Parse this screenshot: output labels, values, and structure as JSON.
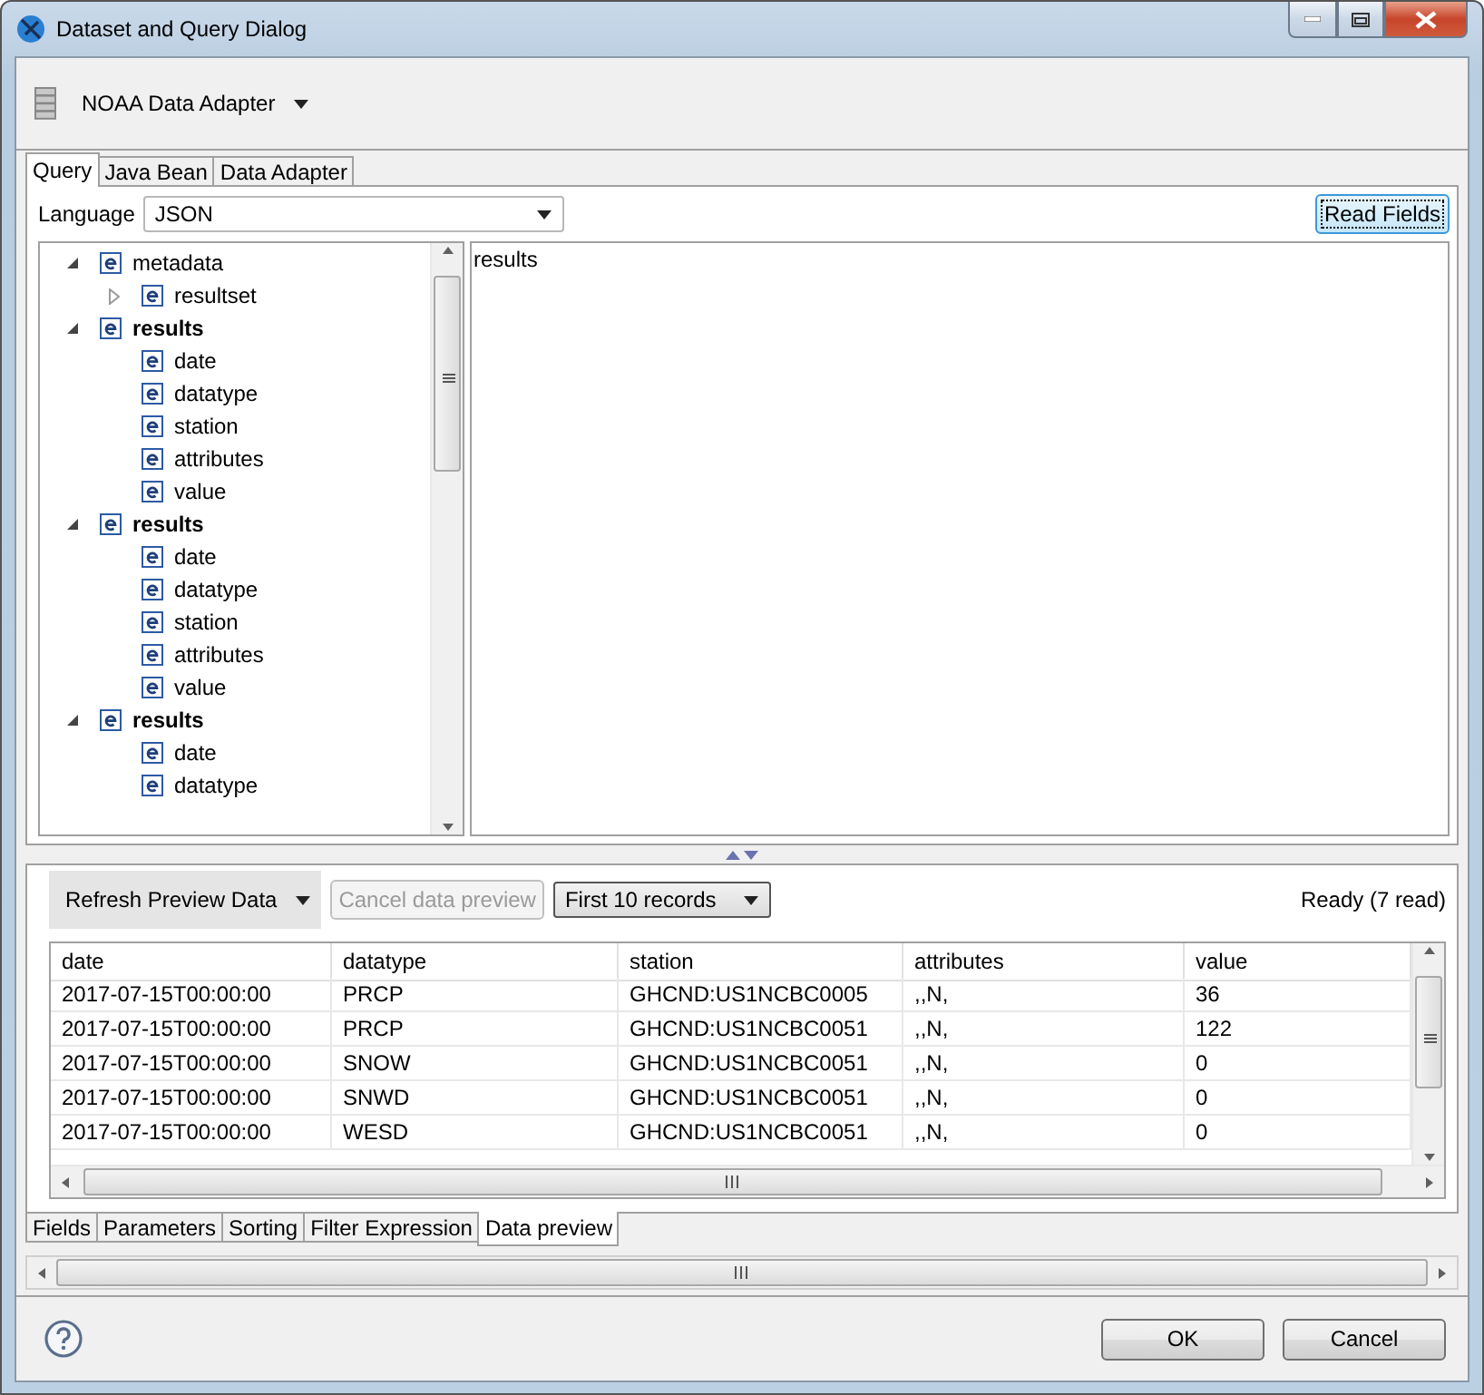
{
  "window": {
    "title": "Dataset and Query Dialog"
  },
  "data_adapter": {
    "label": "NOAA Data Adapter"
  },
  "top_tabs": [
    {
      "label": "Query",
      "selected": true
    },
    {
      "label": "Java Bean",
      "selected": false
    },
    {
      "label": "Data Adapter",
      "selected": false
    }
  ],
  "language": {
    "label": "Language",
    "value": "JSON"
  },
  "read_fields_button": "Read Fields",
  "tree": [
    {
      "label": "metadata",
      "bold": false,
      "expanded": true,
      "children": [
        {
          "label": "resultset",
          "bold": false,
          "expanded": false
        }
      ]
    },
    {
      "label": "results",
      "bold": true,
      "expanded": true,
      "children": [
        {
          "label": "date"
        },
        {
          "label": "datatype"
        },
        {
          "label": "station"
        },
        {
          "label": "attributes"
        },
        {
          "label": "value"
        }
      ]
    },
    {
      "label": "results",
      "bold": true,
      "expanded": true,
      "children": [
        {
          "label": "date"
        },
        {
          "label": "datatype"
        },
        {
          "label": "station"
        },
        {
          "label": "attributes"
        },
        {
          "label": "value"
        }
      ]
    },
    {
      "label": "results",
      "bold": true,
      "expanded": true,
      "children": [
        {
          "label": "date"
        },
        {
          "label": "datatype"
        }
      ]
    }
  ],
  "query_text": "results",
  "preview": {
    "refresh_button": "Refresh Preview Data",
    "cancel_button": {
      "label": "Cancel data preview",
      "disabled": true
    },
    "records_select": "First 10 records",
    "status": "Ready (7 read)"
  },
  "table": {
    "columns": [
      "date",
      "datatype",
      "station",
      "attributes",
      "value"
    ],
    "rows": [
      [
        "2017-07-15T00:00:00",
        "PRCP",
        "GHCND:US1NCBC0005",
        ",,N,",
        "36"
      ],
      [
        "2017-07-15T00:00:00",
        "PRCP",
        "GHCND:US1NCBC0051",
        ",,N,",
        "122"
      ],
      [
        "2017-07-15T00:00:00",
        "SNOW",
        "GHCND:US1NCBC0051",
        ",,N,",
        "0"
      ],
      [
        "2017-07-15T00:00:00",
        "SNWD",
        "GHCND:US1NCBC0051",
        ",,N,",
        "0"
      ],
      [
        "2017-07-15T00:00:00",
        "WESD",
        "GHCND:US1NCBC0051",
        ",,N,",
        "0"
      ]
    ]
  },
  "bottom_tabs": [
    {
      "label": "Fields",
      "selected": false
    },
    {
      "label": "Parameters",
      "selected": false
    },
    {
      "label": "Sorting",
      "selected": false
    },
    {
      "label": "Filter Expression",
      "selected": false
    },
    {
      "label": "Data preview",
      "selected": true
    }
  ],
  "buttons": [
    "OK",
    "Cancel"
  ]
}
